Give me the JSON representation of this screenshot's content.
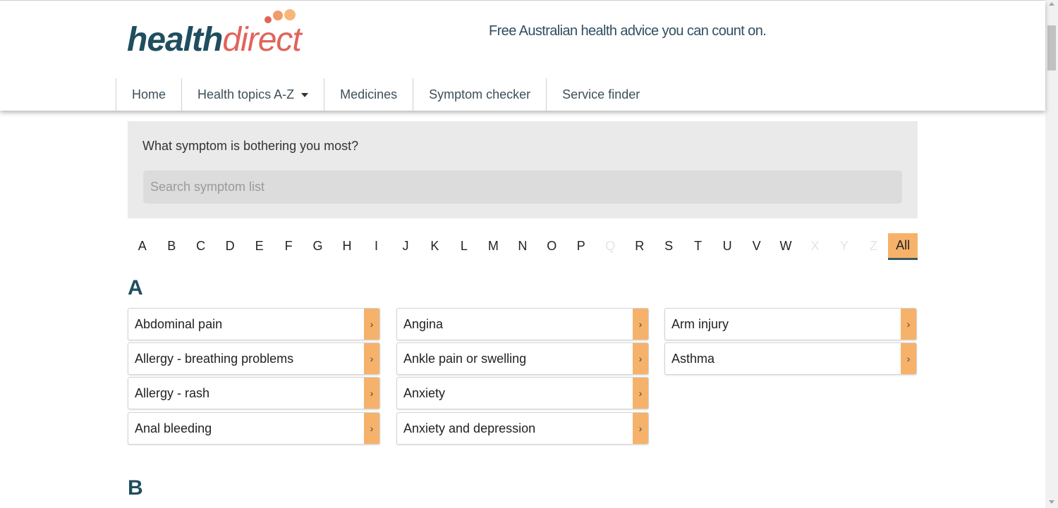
{
  "header": {
    "logo": {
      "part1": "health",
      "part2": "direct",
      "dot_colors": [
        "#e0645a",
        "#f29b6a",
        "#f7b77a"
      ]
    },
    "tagline": "Free Australian health advice you can count on."
  },
  "nav": [
    {
      "label": "Home"
    },
    {
      "label": "Health topics A-Z"
    },
    {
      "label": "Medicines"
    },
    {
      "label": "Symptom checker"
    },
    {
      "label": "Service finder"
    }
  ],
  "search": {
    "question": "What symptom is bothering you most?",
    "placeholder": "Search symptom list",
    "value": ""
  },
  "az_filter": {
    "letters": [
      "A",
      "B",
      "C",
      "D",
      "E",
      "F",
      "G",
      "H",
      "I",
      "J",
      "K",
      "L",
      "M",
      "N",
      "O",
      "P",
      "Q",
      "R",
      "S",
      "T",
      "U",
      "V",
      "W",
      "X",
      "Y",
      "Z",
      "All"
    ],
    "disabled": [
      "Q",
      "X",
      "Y",
      "Z"
    ],
    "active": "All"
  },
  "sections": [
    {
      "letter": "A",
      "items": [
        "Abdominal pain",
        "Allergy - breathing problems",
        "Allergy - rash",
        "Anal bleeding",
        "Angina",
        "Ankle pain or swelling",
        "Anxiety",
        "Anxiety and depression",
        "Arm injury",
        "Asthma"
      ],
      "arrow": "›"
    },
    {
      "letter": "B"
    }
  ],
  "colors": {
    "brand_dark": "#1f4e5f",
    "accent_orange": "#f6b26b",
    "panel_bg": "#eaeaea"
  }
}
